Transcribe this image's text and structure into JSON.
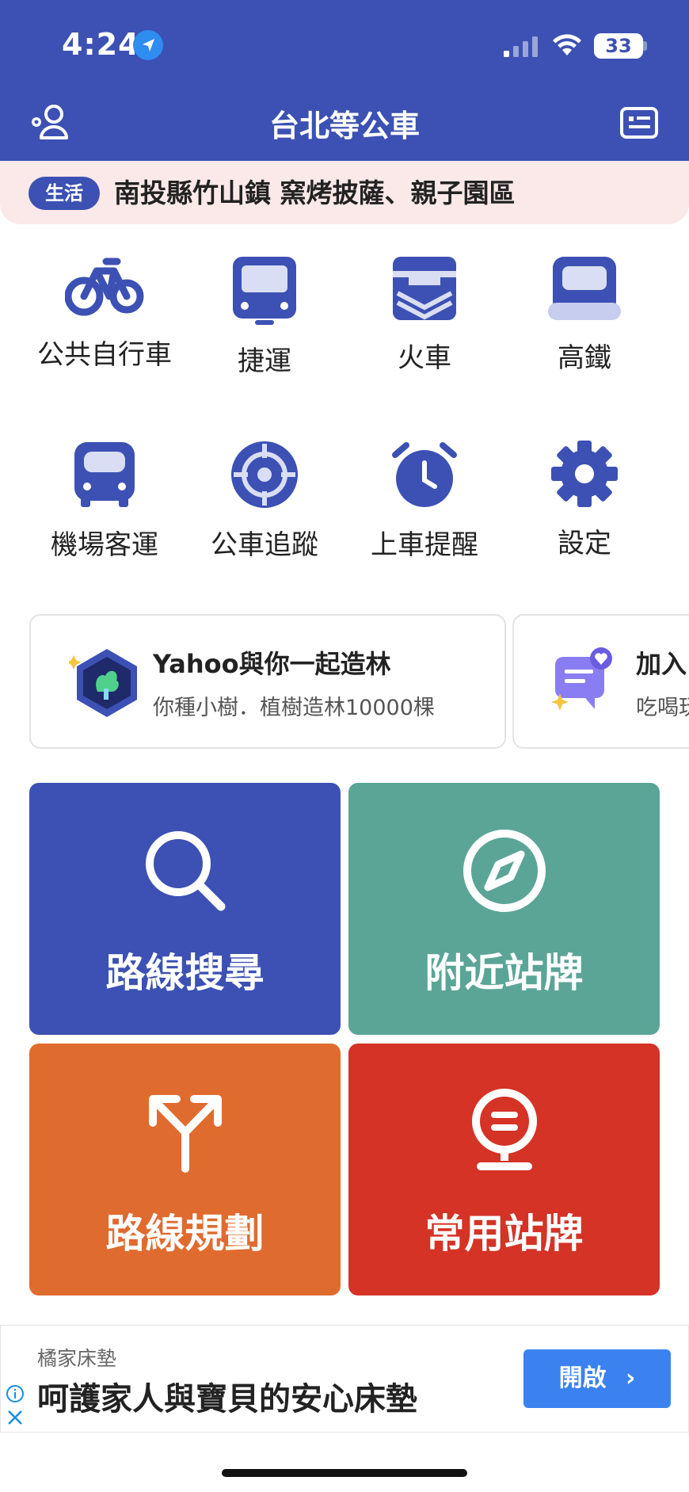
{
  "status_bar": {
    "time": "4:24",
    "battery": "33"
  },
  "header": {
    "title": "台北等公車"
  },
  "banner": {
    "tag": "生活",
    "text": "南投縣竹山鎮 窯烤披薩、親子園區"
  },
  "services": [
    {
      "label": "公共自行車",
      "icon": "bicycle-icon"
    },
    {
      "label": "捷運",
      "icon": "metro-icon"
    },
    {
      "label": "火車",
      "icon": "train-icon"
    },
    {
      "label": "高鐵",
      "icon": "high-speed-rail-icon"
    },
    {
      "label": "機場客運",
      "icon": "airport-bus-icon"
    },
    {
      "label": "公車追蹤",
      "icon": "bus-tracking-icon"
    },
    {
      "label": "上車提醒",
      "icon": "alarm-clock-icon"
    },
    {
      "label": "設定",
      "icon": "gear-icon"
    }
  ],
  "promos": [
    {
      "title": "Yahoo與你一起造林",
      "subtitle": "你種小樹．植樹造林10000棵"
    },
    {
      "title": "加入",
      "subtitle": "吃喝玩"
    }
  ],
  "tiles": [
    {
      "label": "路線搜尋",
      "color": "#3c51b3",
      "icon": "search-icon"
    },
    {
      "label": "附近站牌",
      "color": "#5ba596",
      "icon": "compass-icon"
    },
    {
      "label": "路線規劃",
      "color": "#e06b2f",
      "icon": "route-split-icon"
    },
    {
      "label": "常用站牌",
      "color": "#d43326",
      "icon": "bus-stop-icon"
    }
  ],
  "ad": {
    "brand": "橘家床墊",
    "headline": "呵護家人與寶貝的安心床墊",
    "cta": "開啟"
  },
  "colors": {
    "primary": "#3c51b3",
    "banner_bg": "#fbe9e9",
    "ad_button": "#3b82f0"
  }
}
